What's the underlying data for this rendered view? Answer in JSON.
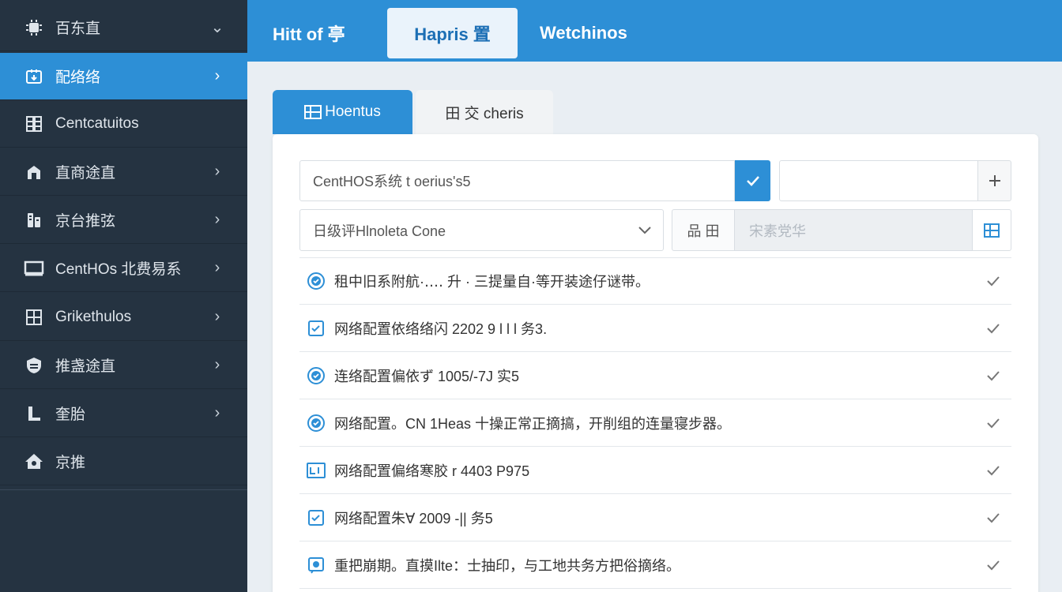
{
  "sidebar": {
    "items": [
      {
        "label": "百东直",
        "icon": "chip-icon",
        "chevron": "⌄"
      },
      {
        "label": "配络络",
        "icon": "network-icon",
        "chevron": "›"
      },
      {
        "label": "Centcatuitos",
        "icon": "server-icon",
        "chevron": ""
      },
      {
        "label": "直商途直",
        "icon": "building-icon",
        "chevron": "›"
      },
      {
        "label": "京台推弦",
        "icon": "settings-icon",
        "chevron": "›"
      },
      {
        "label": "CentHOs 北费易系",
        "icon": "monitor-icon",
        "chevron": "›"
      },
      {
        "label": "Grikethulos",
        "icon": "grid-icon",
        "chevron": "›"
      },
      {
        "label": "推盏途直",
        "icon": "shield-icon",
        "chevron": "›"
      },
      {
        "label": "奎胎",
        "icon": "user-icon",
        "chevron": "›"
      },
      {
        "label": "京推",
        "icon": "home-icon",
        "chevron": ""
      }
    ]
  },
  "header": {
    "tabs": [
      {
        "label": "Hitt of 亭"
      },
      {
        "label": "Hapris 置"
      },
      {
        "label": "Wetchinos"
      }
    ]
  },
  "content": {
    "tabs": [
      {
        "label": "Hoentus"
      },
      {
        "label": "田 交 cheris"
      }
    ],
    "input1_value": "CentHOS系统 t oerius's5",
    "input2_value": "",
    "select_value": "日级评Hlnoleta Cone",
    "field3_label": "品 田",
    "field3_placeholder": "宋素党华"
  },
  "list": {
    "rows": [
      {
        "text": "租中旧系附航·‥‥ 升 · 三提量自·等开装途仔谜带。",
        "icon": "shield-check-icon"
      },
      {
        "text": "网络配置依络络闪 2202 9 l l l 务3.",
        "icon": "doc-icon"
      },
      {
        "text": "连络配置偏依ず 1005/-7J 实5",
        "icon": "shield-check-icon"
      },
      {
        "text": "网络配置。CN 1Heas 十操正常正摘搞，开削组的连量寝步器。",
        "icon": "shield-check-icon"
      },
      {
        "text": "网络配置偏络寒胶 r 4403 P975",
        "icon": "terminal-icon"
      },
      {
        "text": "网络配置朱∀ 2009 -|| 务5",
        "icon": "doc-icon"
      },
      {
        "text": "重把崩期。直摸Ilte：士抽印，与工地共务方把俗摘络。",
        "icon": "chat-icon"
      }
    ]
  },
  "colors": {
    "accent": "#2d8fd6",
    "sidebar_bg": "#253341",
    "icon_blue": "#2d8fd6"
  }
}
